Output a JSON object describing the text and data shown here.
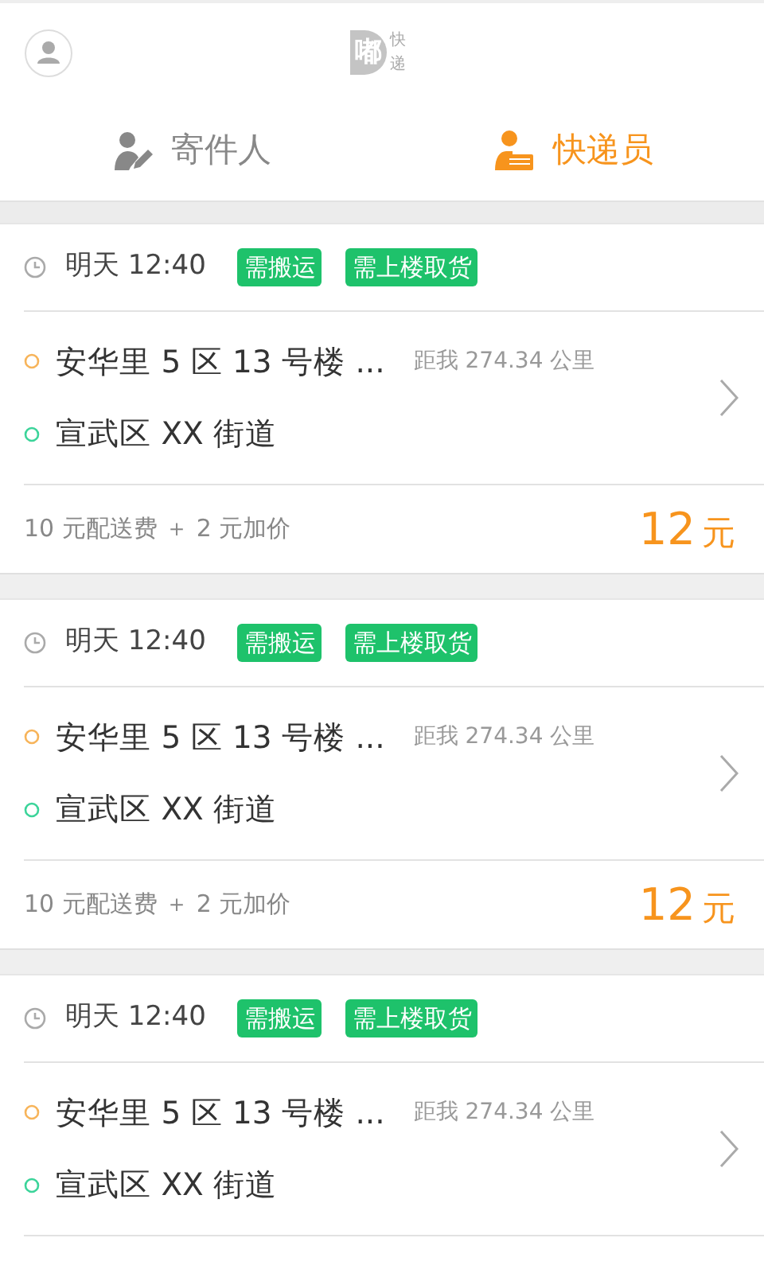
{
  "header": {
    "logo_mark": "嘟",
    "logo_text": "快递"
  },
  "tabs": [
    {
      "label": "寄件人",
      "selected": false,
      "kind": "sender"
    },
    {
      "label": "快递员",
      "selected": true,
      "kind": "courier"
    }
  ],
  "orders": [
    {
      "time": "明天 12:40",
      "tags": [
        "需搬运",
        "需上楼取货"
      ],
      "from": "安华里 5 区 13 号楼 ...",
      "distance": "距我 274.34 公里",
      "to": "宣武区 XX 街道",
      "fee": "10 元配送费 ＋ 2 元加价",
      "price": "12",
      "unit": "元"
    },
    {
      "time": "明天 12:40",
      "tags": [
        "需搬运",
        "需上楼取货"
      ],
      "from": "安华里 5 区 13 号楼 ...",
      "distance": "距我 274.34 公里",
      "to": "宣武区 XX 街道",
      "fee": "10 元配送费 ＋ 2 元加价",
      "price": "12",
      "unit": "元"
    },
    {
      "time": "明天 12:40",
      "tags": [
        "需搬运",
        "需上楼取货"
      ],
      "from": "安华里 5 区 13 号楼 ...",
      "distance": "距我 274.34 公里",
      "to": "宣武区 XX 街道"
    }
  ]
}
